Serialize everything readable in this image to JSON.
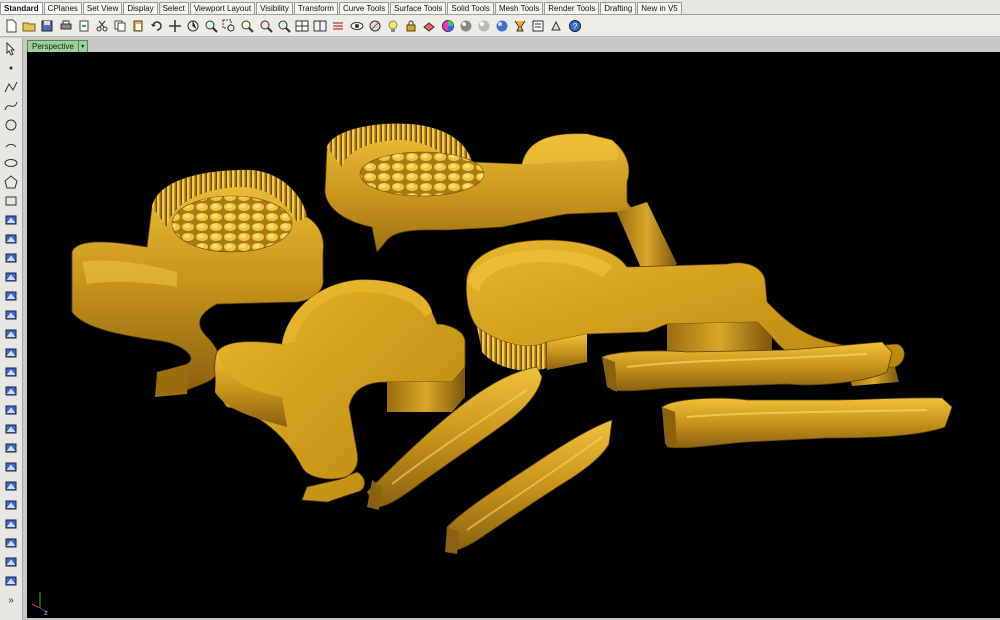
{
  "menu_tabs": [
    {
      "label": "Standard",
      "active": true
    },
    {
      "label": "CPlanes"
    },
    {
      "label": "Set View"
    },
    {
      "label": "Display"
    },
    {
      "label": "Select"
    },
    {
      "label": "Viewport Layout"
    },
    {
      "label": "Visibility"
    },
    {
      "label": "Transform"
    },
    {
      "label": "Curve Tools"
    },
    {
      "label": "Surface Tools"
    },
    {
      "label": "Solid Tools"
    },
    {
      "label": "Mesh Tools"
    },
    {
      "label": "Render Tools"
    },
    {
      "label": "Drafting"
    },
    {
      "label": "New in V5"
    }
  ],
  "toolbar_icons": [
    "new-file-icon",
    "open-file-icon",
    "save-icon",
    "print-icon",
    "import-icon",
    "cut-icon",
    "copy-icon",
    "paste-icon",
    "undo-icon",
    "pan-icon",
    "rotate-view-icon",
    "zoom-icon",
    "zoom-window-icon",
    "zoom-extents-icon",
    "zoom-selected-icon",
    "zoom-previous-icon",
    "viewport-layout-icon",
    "four-viewports-icon",
    "grid-icon",
    "visibility-icon",
    "hide-icon",
    "lightbulb-icon",
    "lock-icon",
    "layer-icon",
    "color-wheel-icon",
    "shaded-sphere-icon",
    "render-sphere-icon",
    "material-sphere-icon",
    "options-icon",
    "properties-icon",
    "command-icon",
    "help-icon"
  ],
  "sidebar_icons": [
    "select-arrow-icon",
    "point-icon",
    "polyline-icon",
    "curve-icon",
    "circle-icon",
    "arc-icon",
    "ellipse-icon",
    "polygon-icon",
    "rectangle-icon",
    "offset-icon",
    "fillet-icon",
    "trim-icon",
    "surface-icon",
    "extrude-icon",
    "box-icon",
    "sphere-icon",
    "mesh-icon",
    "boolean-icon",
    "explode-icon",
    "split-icon",
    "move-icon",
    "array-icon",
    "dimension-icon",
    "text-icon",
    "analyze-icon",
    "render-icon",
    "transform-icon",
    "layout-icon",
    "block-icon",
    "more-icon"
  ],
  "viewport": {
    "label": "Perspective",
    "menu_arrow": "▾",
    "background": "#000000",
    "object_color": "#b8860b",
    "object_highlight": "#e6b422",
    "object_shadow": "#5a3f05"
  },
  "axis": {
    "x_label": "x",
    "y_label": "y",
    "z_label": "z"
  },
  "colors": {
    "tab_bg": "#f4f4f0",
    "toolbar_bg": "#eeece6",
    "sidebar_bg": "#e9e7e1",
    "viewport_tab": "#9ccf9c"
  }
}
